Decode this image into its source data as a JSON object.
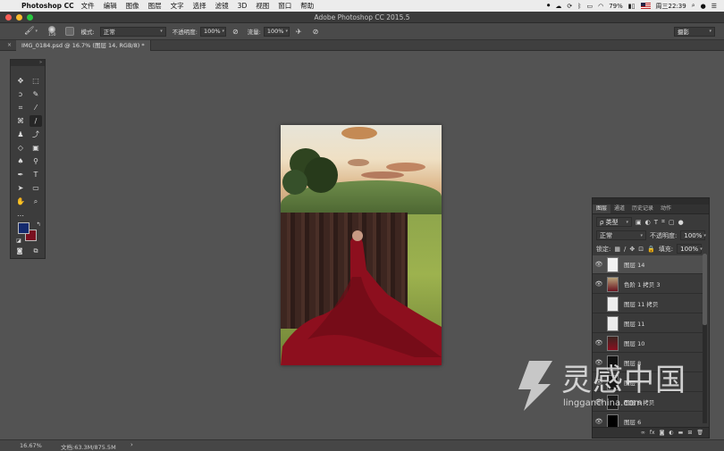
{
  "menubar": {
    "app_name": "Photoshop CC",
    "items": [
      "文件",
      "编辑",
      "图像",
      "图层",
      "文字",
      "选择",
      "滤镜",
      "3D",
      "视图",
      "窗口",
      "帮助"
    ],
    "battery": "79%",
    "clock": "周三22:39"
  },
  "window": {
    "title": "Adobe Photoshop CC 2015.5"
  },
  "options": {
    "brush_size": "150",
    "mode_label": "模式:",
    "mode_value": "正常",
    "opacity_label": "不透明度:",
    "opacity_value": "100%",
    "flow_label": "流量:",
    "flow_value": "100%",
    "workspace": "摄影"
  },
  "document_tab": {
    "label": "IMG_0184.psd @ 16.7% (图层 14, RGB/8) *"
  },
  "tools": {
    "icons": [
      "move-icon",
      "marquee-icon",
      "lasso-icon",
      "quick-select-icon",
      "crop-icon",
      "eyedropper-icon",
      "healing-icon",
      "brush-icon",
      "stamp-icon",
      "history-brush-icon",
      "eraser-icon",
      "gradient-icon",
      "blur-icon",
      "dodge-icon",
      "pen-icon",
      "type-icon",
      "path-select-icon",
      "rectangle-icon",
      "hand-icon",
      "zoom-icon"
    ],
    "foreground_color": "#142a6e",
    "background_color": "#7a1020"
  },
  "layers_panel": {
    "tabs": [
      "图层",
      "通道",
      "历史记录",
      "动作"
    ],
    "filter_label": "ρ 类型",
    "blend_mode": "正常",
    "opacity_label": "不透明度:",
    "opacity_value": "100%",
    "lock_label": "锁定:",
    "fill_label": "填充:",
    "fill_value": "100%",
    "layers": [
      {
        "name": "图层 14",
        "visible": true,
        "selected": true
      },
      {
        "name": "色阶 1 拷贝 3",
        "visible": true,
        "selected": false
      },
      {
        "name": "图层 11 拷贝",
        "visible": false,
        "selected": false
      },
      {
        "name": "图层 11",
        "visible": false,
        "selected": false
      },
      {
        "name": "图层 10",
        "visible": true,
        "selected": false
      },
      {
        "name": "图层 8",
        "visible": true,
        "selected": false
      },
      {
        "name": "图层 7",
        "visible": true,
        "selected": false
      },
      {
        "name": "图层 6 拷贝",
        "visible": true,
        "selected": false
      },
      {
        "name": "图层 6",
        "visible": true,
        "selected": false
      }
    ]
  },
  "status": {
    "zoom": "16.67%",
    "doc_size": "文档:63.3M/875.5M"
  },
  "watermark": {
    "title": "灵感中国",
    "url": "lingganchina.com"
  }
}
